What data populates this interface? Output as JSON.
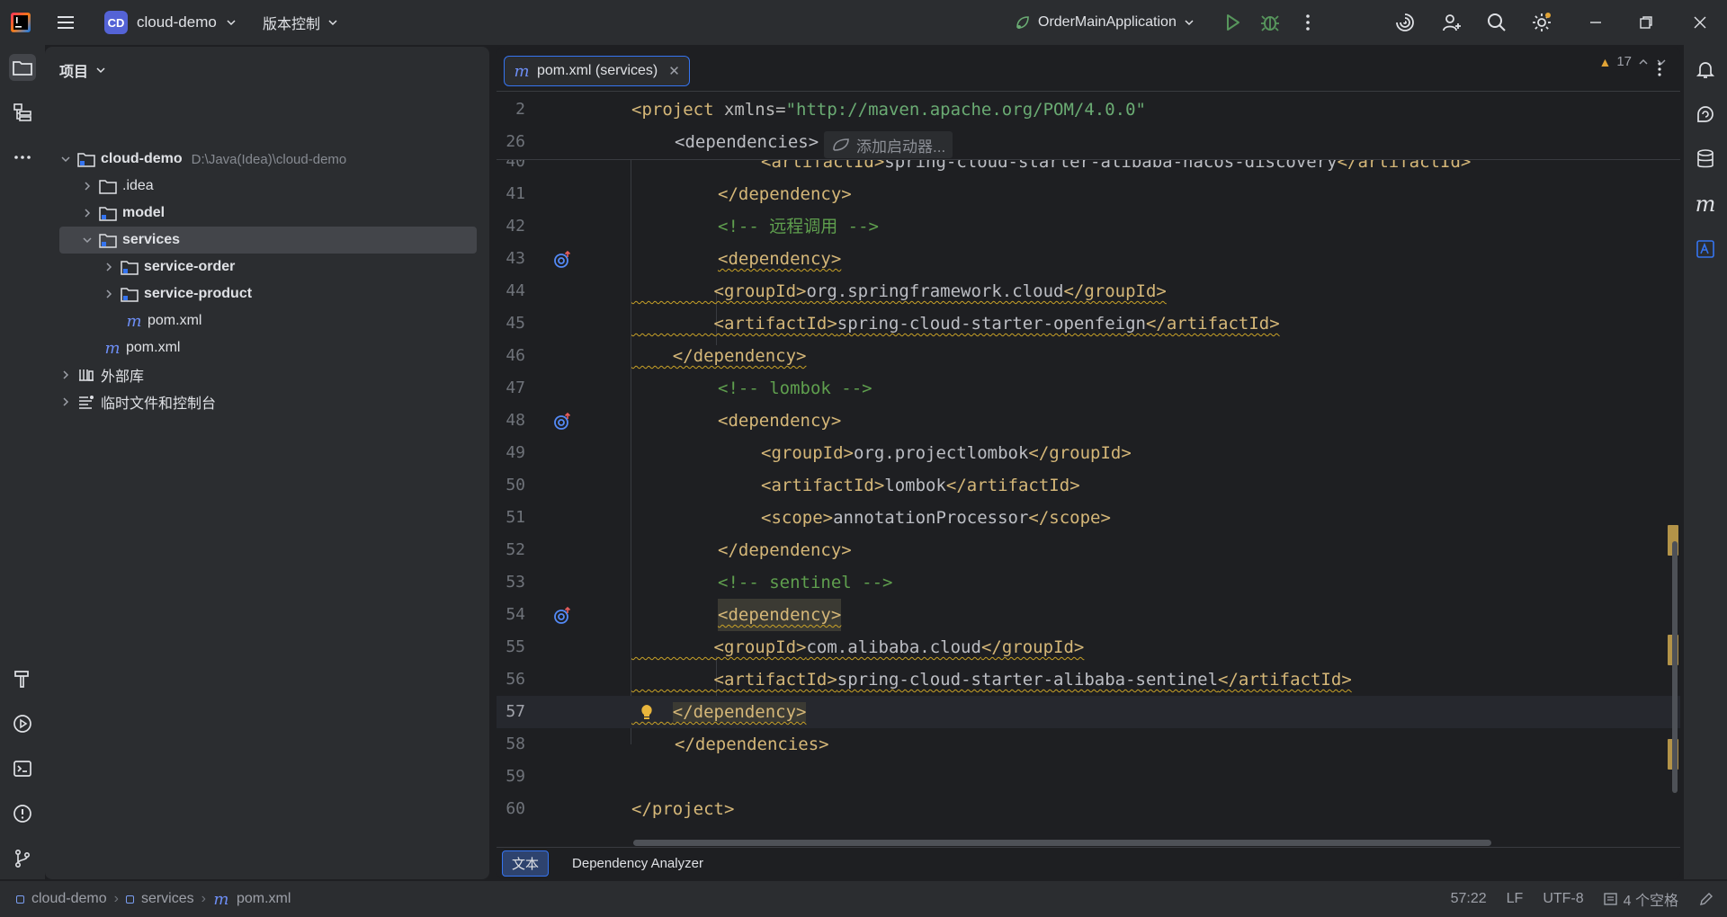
{
  "titlebar": {
    "project_badge": "CD",
    "project_name": "cloud-demo",
    "vcs_label": "版本控制",
    "run_config": "OrderMainApplication"
  },
  "project_panel": {
    "title": "项目",
    "tree": [
      {
        "label": "cloud-demo",
        "path": "D:\\Java(Idea)\\cloud-demo"
      },
      {
        "label": ".idea"
      },
      {
        "label": "model"
      },
      {
        "label": "services"
      },
      {
        "label": "service-order"
      },
      {
        "label": "service-product"
      },
      {
        "label": "pom.xml"
      },
      {
        "label": "pom.xml"
      },
      {
        "label": "外部库"
      },
      {
        "label": "临时文件和控制台"
      }
    ]
  },
  "editor": {
    "tab_label": "pom.xml (services)",
    "warning_count": "17",
    "hint": "添加启动器...",
    "sticky": [
      {
        "num": "2",
        "code": "<project xmlns=\"http://maven.apache.org/POM/4.0.0\""
      },
      {
        "num": "26",
        "code": "<dependencies>"
      }
    ],
    "lines": [
      {
        "num": "40",
        "code": "<artifactId>spring-cloud-starter-alibaba-nacos-discovery</artifactId>"
      },
      {
        "num": "41",
        "code": "</dependency>"
      },
      {
        "num": "42",
        "code": "<!-- 远程调用 -->"
      },
      {
        "num": "43",
        "code": "<dependency>"
      },
      {
        "num": "44",
        "code": "<groupId>org.springframework.cloud</groupId>"
      },
      {
        "num": "45",
        "code": "<artifactId>spring-cloud-starter-openfeign</artifactId>"
      },
      {
        "num": "46",
        "code": "</dependency>"
      },
      {
        "num": "47",
        "code": "<!-- lombok -->"
      },
      {
        "num": "48",
        "code": "<dependency>"
      },
      {
        "num": "49",
        "code": "<groupId>org.projectlombok</groupId>"
      },
      {
        "num": "50",
        "code": "<artifactId>lombok</artifactId>"
      },
      {
        "num": "51",
        "code": "<scope>annotationProcessor</scope>"
      },
      {
        "num": "52",
        "code": "</dependency>"
      },
      {
        "num": "53",
        "code": "<!-- sentinel -->"
      },
      {
        "num": "54",
        "code": "<dependency>"
      },
      {
        "num": "55",
        "code": "<groupId>com.alibaba.cloud</groupId>"
      },
      {
        "num": "56",
        "code": "<artifactId>spring-cloud-starter-alibaba-sentinel</artifactId>"
      },
      {
        "num": "57",
        "code": "</dependency>"
      },
      {
        "num": "58",
        "code": "</dependencies>"
      },
      {
        "num": "59",
        "code": ""
      },
      {
        "num": "60",
        "code": "</project>"
      }
    ],
    "bottom_tabs": [
      "文本",
      "Dependency Analyzer"
    ]
  },
  "statusbar": {
    "crumbs": [
      "cloud-demo",
      "services",
      "pom.xml"
    ],
    "position": "57:22",
    "line_sep": "LF",
    "encoding": "UTF-8",
    "indent": "4 个空格"
  },
  "colors": {
    "accent": "#3574f0",
    "tag": "#d5b778",
    "string": "#6aab73",
    "comment": "#5f9f4e",
    "warning": "#e0a336"
  }
}
